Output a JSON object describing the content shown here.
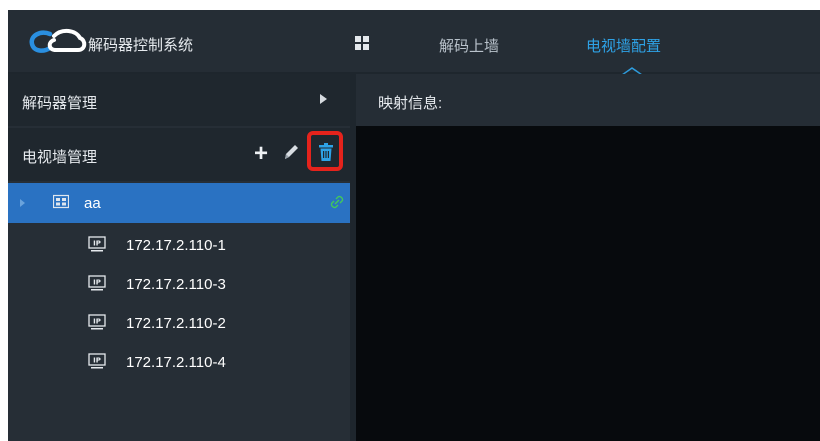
{
  "app": {
    "title": "解码器控制系统"
  },
  "nav": {
    "items": [
      {
        "label": "解码上墙"
      },
      {
        "label": "电视墙配置"
      }
    ],
    "active": "电视墙配置"
  },
  "sidebar": {
    "sections": [
      {
        "label": "解码器管理"
      },
      {
        "label": "电视墙管理"
      }
    ],
    "tree": {
      "wall": {
        "label": "aa"
      },
      "decoders": [
        {
          "label": "172.17.2.110-1"
        },
        {
          "label": "172.17.2.110-3"
        },
        {
          "label": "172.17.2.110-2"
        },
        {
          "label": "172.17.2.110-4"
        }
      ]
    }
  },
  "main": {
    "mapping_label": "映射信息:"
  },
  "icons": [
    "cloud-logo-icon",
    "grid-icon",
    "caret-right-icon",
    "plus-icon",
    "pencil-icon",
    "trash-icon",
    "tv-wall-icon",
    "link-icon",
    "ip-monitor-icon"
  ],
  "colors": {
    "accent": "#2ea2e6",
    "selected_row": "#2a72c2",
    "highlight_box": "#e5231c"
  }
}
